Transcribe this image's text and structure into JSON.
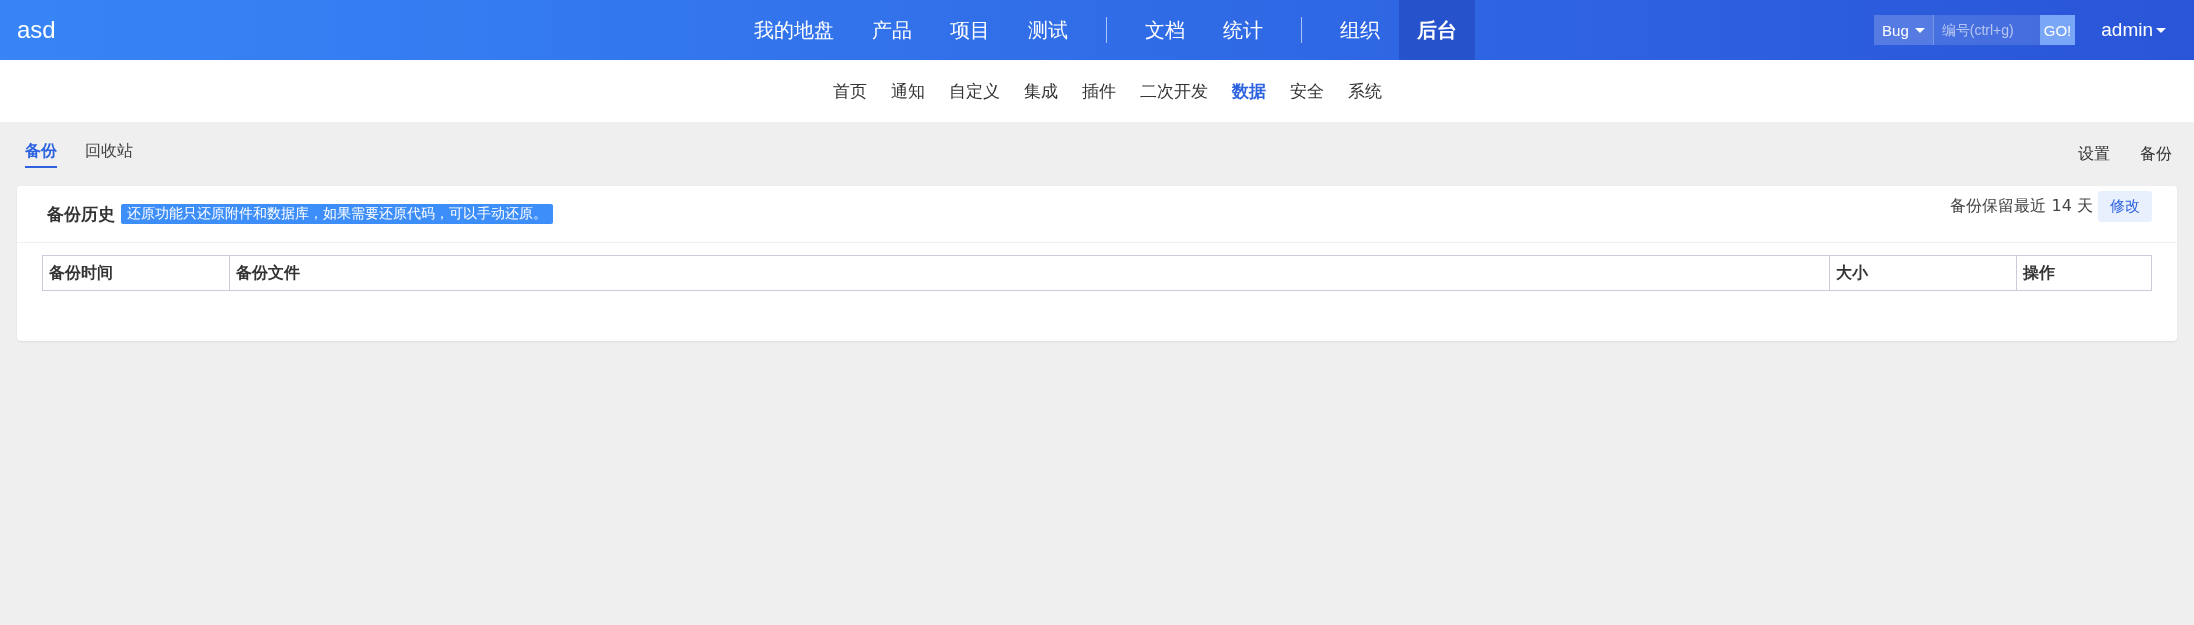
{
  "header": {
    "logo": "asd",
    "nav_groups": [
      {
        "items": [
          {
            "label": "我的地盘",
            "selected": false
          },
          {
            "label": "产品",
            "selected": false
          },
          {
            "label": "项目",
            "selected": false
          },
          {
            "label": "测试",
            "selected": false
          }
        ]
      },
      {
        "items": [
          {
            "label": "文档",
            "selected": false
          },
          {
            "label": "统计",
            "selected": false
          }
        ]
      },
      {
        "items": [
          {
            "label": "组织",
            "selected": false
          },
          {
            "label": "后台",
            "selected": true
          }
        ]
      }
    ],
    "search": {
      "type": "Bug",
      "placeholder": "编号(ctrl+g)",
      "go": "GO!"
    },
    "user": "admin"
  },
  "subnav": [
    {
      "label": "首页",
      "selected": false
    },
    {
      "label": "通知",
      "selected": false
    },
    {
      "label": "自定义",
      "selected": false
    },
    {
      "label": "集成",
      "selected": false
    },
    {
      "label": "插件",
      "selected": false
    },
    {
      "label": "二次开发",
      "selected": false
    },
    {
      "label": "数据",
      "selected": true
    },
    {
      "label": "安全",
      "selected": false
    },
    {
      "label": "系统",
      "selected": false
    }
  ],
  "tabs": [
    {
      "label": "备份",
      "selected": true
    },
    {
      "label": "回收站",
      "selected": false
    }
  ],
  "actions": [
    "设置",
    "备份"
  ],
  "panel": {
    "title": "备份历史",
    "notice": "还原功能只还原附件和数据库，如果需要还原代码，可以手动还原。",
    "retention": "备份保留最近 14 天",
    "edit": "修改",
    "table": {
      "columns": [
        "备份时间",
        "备份文件",
        "大小",
        "操作"
      ]
    }
  }
}
